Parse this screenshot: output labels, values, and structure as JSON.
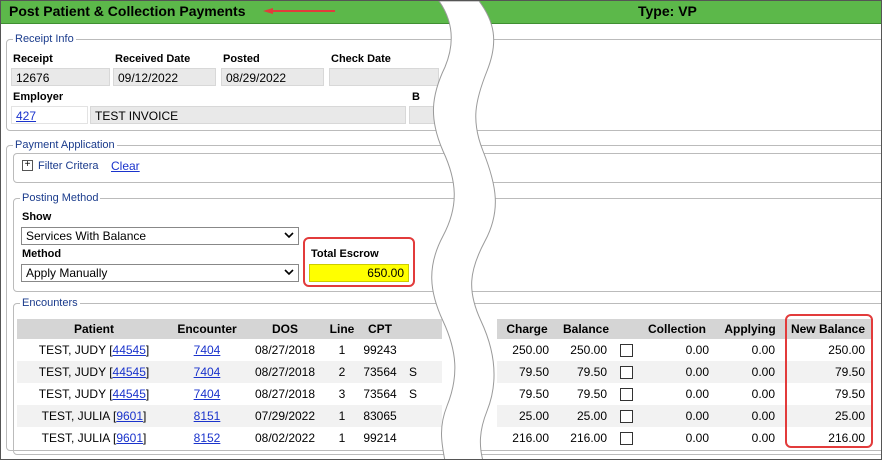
{
  "header": {
    "title": "Post Patient & Collection Payments",
    "type_label": "Type: VP",
    "colors": {
      "bar": "#5cb84a",
      "arrow": "#e23b3b"
    }
  },
  "receipt_info": {
    "legend": "Receipt Info",
    "receipt_label": "Receipt",
    "receipt": "12676",
    "received_date_label": "Received Date",
    "received_date": "09/12/2022",
    "posted_label": "Posted",
    "posted": "08/29/2022",
    "check_date_label": "Check Date",
    "check_date": "",
    "employer_label": "Employer",
    "employer_id": "427",
    "employer_name": "TEST INVOICE",
    "cut_label": "B"
  },
  "payment_application": {
    "legend": "Payment Application",
    "expand_symbol": "+",
    "filter_label": "Filter Critera",
    "clear_label": "Clear"
  },
  "posting_method": {
    "legend": "Posting Method",
    "show_label": "Show",
    "show_value": "Services With Balance",
    "method_label": "Method",
    "method_value": "Apply Manually",
    "total_escrow_label": "Total Escrow",
    "total_escrow": "650.00",
    "escrow_color": "#ffff00"
  },
  "encounters": {
    "legend": "Encounters",
    "headers_left": [
      "Patient",
      "Encounter",
      "DOS",
      "Line",
      "CPT"
    ],
    "headers_right": [
      "Charge",
      "Balance",
      "",
      "Collection",
      "Applying",
      "New Balance"
    ],
    "rows": [
      {
        "patient": "TEST, JUDY",
        "patient_id": "44545",
        "encounter": "7404",
        "dos": "08/27/2018",
        "line": "1",
        "cpt": "99243",
        "cut": "",
        "charge": "250.00",
        "balance": "250.00",
        "collection": "0.00",
        "applying": "0.00",
        "new_balance": "250.00"
      },
      {
        "patient": "TEST, JUDY",
        "patient_id": "44545",
        "encounter": "7404",
        "dos": "08/27/2018",
        "line": "2",
        "cpt": "73564",
        "cut": "S",
        "charge": "79.50",
        "balance": "79.50",
        "collection": "0.00",
        "applying": "0.00",
        "new_balance": "79.50"
      },
      {
        "patient": "TEST, JUDY",
        "patient_id": "44545",
        "encounter": "7404",
        "dos": "08/27/2018",
        "line": "3",
        "cpt": "73564",
        "cut": "S",
        "charge": "79.50",
        "balance": "79.50",
        "collection": "0.00",
        "applying": "0.00",
        "new_balance": "79.50"
      },
      {
        "patient": "TEST, JULIA",
        "patient_id": "9601",
        "encounter": "8151",
        "dos": "07/29/2022",
        "line": "1",
        "cpt": "83065",
        "cut": "",
        "charge": "25.00",
        "balance": "25.00",
        "collection": "0.00",
        "applying": "0.00",
        "new_balance": "25.00"
      },
      {
        "patient": "TEST, JULIA",
        "patient_id": "9601",
        "encounter": "8152",
        "dos": "08/02/2022",
        "line": "1",
        "cpt": "99214",
        "cut": "",
        "charge": "216.00",
        "balance": "216.00",
        "collection": "0.00",
        "applying": "0.00",
        "new_balance": "216.00"
      }
    ]
  }
}
